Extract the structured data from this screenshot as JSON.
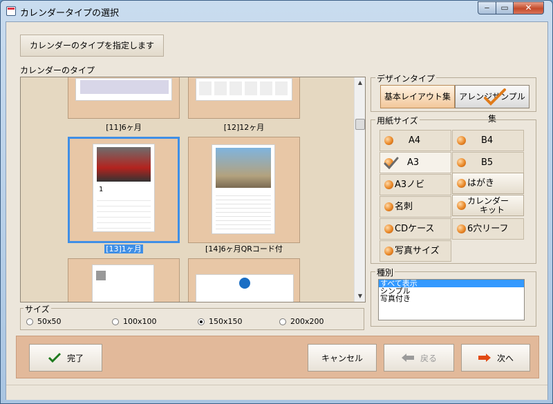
{
  "window": {
    "title": "カレンダータイプの選択",
    "minimize": "‒",
    "maximize": "▭",
    "close": "✕"
  },
  "instruction_button": "カレンダーのタイプを指定します",
  "type_section_label": "カレンダーのタイプ",
  "thumbnails": [
    {
      "label": "[11]6ヶ月"
    },
    {
      "label": "[12]12ヶ月"
    },
    {
      "label": "[13]1ヶ月",
      "selected": true
    },
    {
      "label": "[14]6ヶ月QRコード付"
    }
  ],
  "size_group": {
    "title": "サイズ",
    "options": [
      "50x50",
      "100x100",
      "150x150",
      "200x200"
    ],
    "selected": "150x150"
  },
  "design_type": {
    "title": "デザインタイプ",
    "options": [
      "基本レイアウト集",
      "アレンジサンプル集"
    ],
    "selected": "アレンジサンプル集"
  },
  "paper_size": {
    "title": "用紙サイズ",
    "items": [
      "A4",
      "B4",
      "A3",
      "B5",
      "A3ノビ",
      "はがき",
      "名刺",
      "カレンダー",
      "キット",
      "CDケース",
      "6穴リーフ",
      "写真サイズ"
    ],
    "selected": "A3"
  },
  "kind": {
    "title": "種別",
    "items": [
      "すべて表示",
      "シンプル",
      "写真付き"
    ],
    "selected": "すべて表示"
  },
  "buttons": {
    "finish": "完了",
    "cancel": "キャンセル",
    "back": "戻る",
    "next": "次へ"
  },
  "colors": {
    "selection": "#3f8fe6",
    "accent_orange": "#ea8a2a",
    "check": "#e07b1a"
  }
}
